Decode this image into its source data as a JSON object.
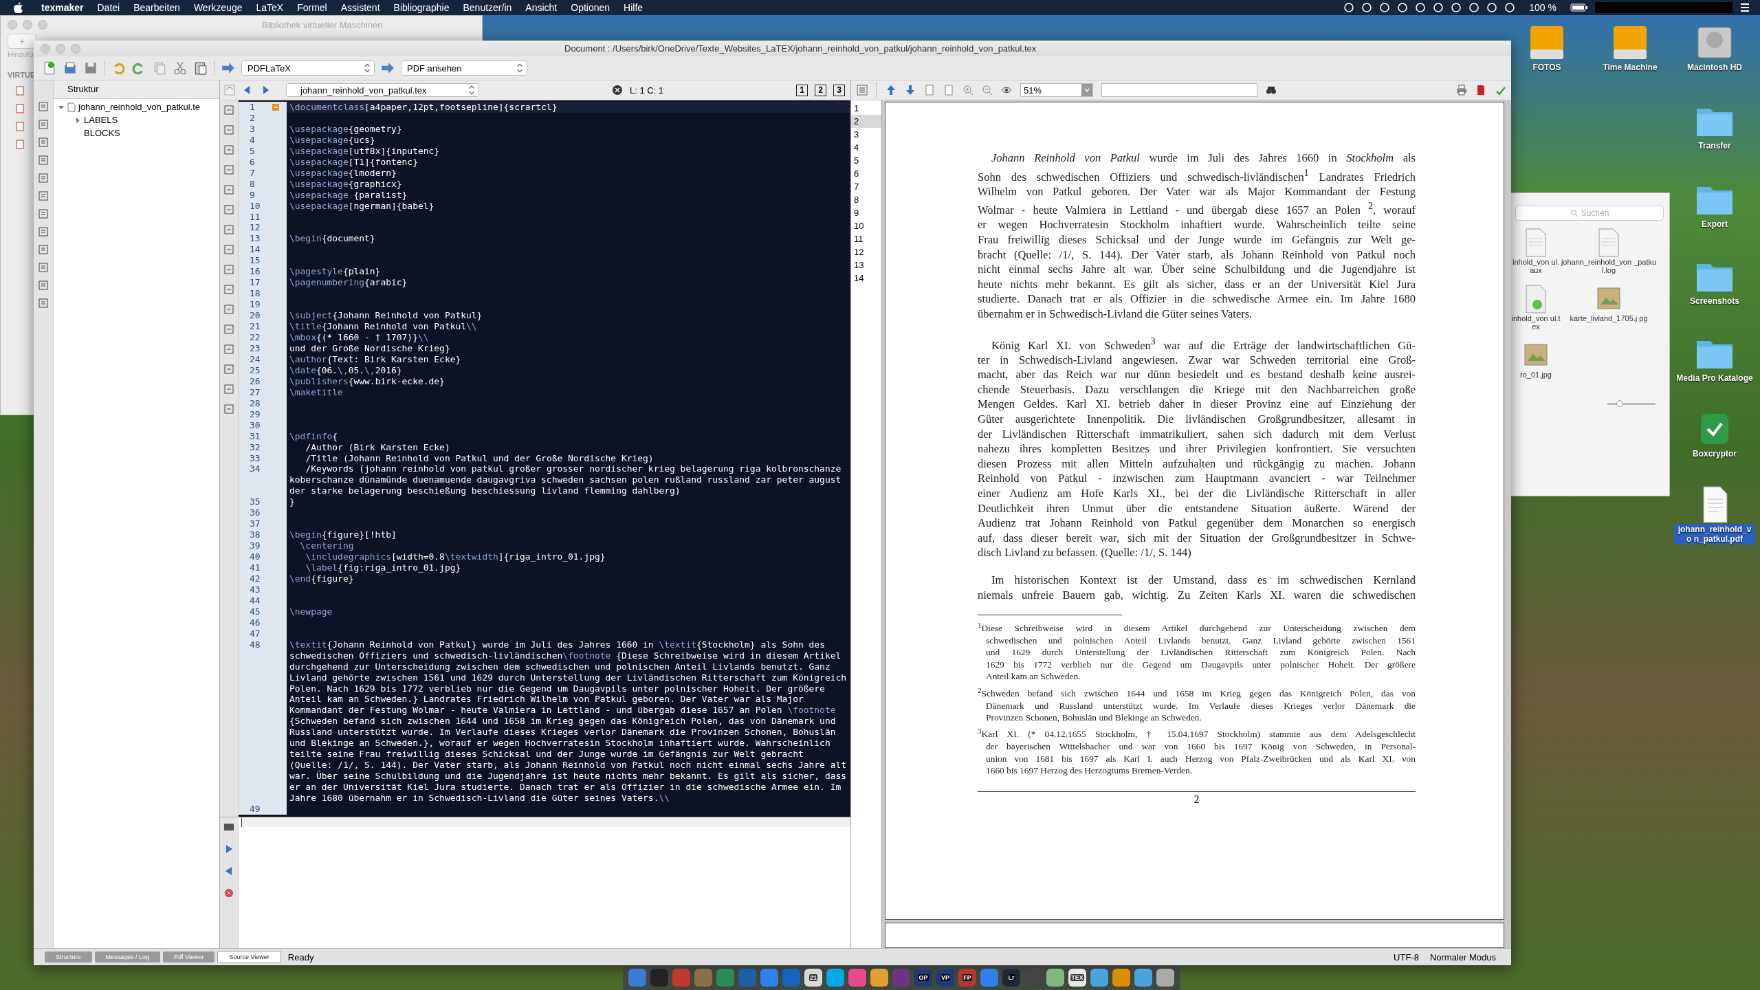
{
  "menubar": {
    "items": [
      {
        "label": "texmaker",
        "kind": "app"
      },
      {
        "label": "Datei",
        "kind": "menu"
      },
      {
        "label": "Bearbeiten",
        "kind": "menu"
      },
      {
        "label": "Werkzeuge",
        "kind": "menu"
      },
      {
        "label": "LaTeX",
        "kind": "menu"
      },
      {
        "label": "Formel",
        "kind": "menu"
      },
      {
        "label": "Assistent",
        "kind": "menu"
      },
      {
        "label": "Bibliographie",
        "kind": "menu"
      },
      {
        "label": "Benutzer/in",
        "kind": "menu"
      },
      {
        "label": "Ansicht",
        "kind": "menu"
      },
      {
        "label": "Optionen",
        "kind": "menu"
      },
      {
        "label": "Hilfe",
        "kind": "menu"
      }
    ],
    "battery": "100 %"
  },
  "vm_window": {
    "title": "Bibliothek virtueller Maschinen",
    "add_button": "+",
    "add_label": "Hinzufü",
    "section": "VIRTUE"
  },
  "desktop_icons": [
    {
      "label": "FOTOS",
      "kind": "drive",
      "selected": false
    },
    {
      "label": "Time Machine",
      "kind": "drive",
      "selected": false
    },
    {
      "label": "Macintosh HD",
      "kind": "disk",
      "selected": false
    },
    {
      "label": "Transfer",
      "kind": "folder",
      "selected": false
    },
    {
      "label": "Export",
      "kind": "folder",
      "selected": false
    },
    {
      "label": "Screenshots",
      "kind": "folder",
      "selected": false
    },
    {
      "label": "Media Pro Kataloge",
      "kind": "folder",
      "selected": false
    },
    {
      "label": "Boxcryptor",
      "kind": "app",
      "selected": false
    },
    {
      "label": "johann_reinhold_vo n_patkul.pdf",
      "kind": "document",
      "selected": true
    }
  ],
  "finder": {
    "search_placeholder": "Suchen",
    "files": [
      {
        "label": "inhold_von ul.aux",
        "kind": "document"
      },
      {
        "label": "johann_reinhold_von _patkul.log",
        "kind": "log"
      },
      {
        "label": "inhold_von ul.tex",
        "kind": "tex"
      },
      {
        "label": "karte_livland_1705.j pg",
        "kind": "image"
      },
      {
        "label": "ro_01.jpg",
        "kind": "image"
      }
    ],
    "icon_size": {
      "level": 0.25
    }
  },
  "window": {
    "title": "Document : /Users/birk/OneDrive/Texte_Websites_LaTEX/johann_reinhold_von_patkul/johann_reinhold_von_patkul.tex"
  },
  "toolbar": {
    "build_command": "PDFLaTeX",
    "view_command": "PDF ansehen"
  },
  "structure": {
    "title": "Struktur",
    "tree": [
      {
        "label": "johann_reinhold_von_patkul.te",
        "expanded": true,
        "children": [
          {
            "label": "LABELS",
            "expanded": false
          },
          {
            "label": "BLOCKS"
          }
        ]
      }
    ]
  },
  "editor": {
    "file_tab": "johann_reinhold_von_patkul.tex",
    "cursor": "L: 1 C: 1",
    "view_buttons": [
      "1",
      "2",
      "3"
    ],
    "lines": [
      {
        "n": "1",
        "text": "\\documentclass[a4paper,12pt,footsepline]{scrartcl}",
        "fold_start": true,
        "current": true
      },
      {
        "n": "2"
      },
      {
        "n": "3",
        "text": "\\usepackage{geometry}"
      },
      {
        "n": "4",
        "text": "\\usepackage{ucs}"
      },
      {
        "n": "5",
        "text": "\\usepackage[utf8x]{inputenc}"
      },
      {
        "n": "6",
        "text": "\\usepackage[T1]{fontenc}"
      },
      {
        "n": "7",
        "text": "\\usepackage{lmodern}"
      },
      {
        "n": "8",
        "text": "\\usepackage{graphicx}"
      },
      {
        "n": "9",
        "text": "\\usepackage {paralist}"
      },
      {
        "n": "10",
        "text": "\\usepackage[ngerman]{babel}"
      },
      {
        "n": "11"
      },
      {
        "n": "12"
      },
      {
        "n": "13",
        "text": "\\begin{document}"
      },
      {
        "n": "14"
      },
      {
        "n": "15"
      },
      {
        "n": "16",
        "text": "\\pagestyle{plain}"
      },
      {
        "n": "17",
        "text": "\\pagenumbering{arabic}"
      },
      {
        "n": "18"
      },
      {
        "n": "19"
      },
      {
        "n": "20",
        "text": "\\subject{Johann Reinhold von Patkul}"
      },
      {
        "n": "21",
        "text": "\\title{Johann Reinhold von Patkul\\\\"
      },
      {
        "n": "22",
        "text": "\\mbox{(* 1660 - † 1707)}\\\\"
      },
      {
        "n": "23",
        "text": "und der Große Nordische Krieg}"
      },
      {
        "n": "24",
        "text": "\\author{Text: Birk Karsten Ecke}"
      },
      {
        "n": "25",
        "text": "\\date{06.\\,05.\\,2016}"
      },
      {
        "n": "26",
        "text": "\\publishers{www.birk-ecke.de}"
      },
      {
        "n": "27",
        "text": "\\maketitle"
      },
      {
        "n": "28"
      },
      {
        "n": "29"
      },
      {
        "n": "30"
      },
      {
        "n": "31",
        "text": "\\pdfinfo{"
      },
      {
        "n": "32",
        "text": "   /Author (Birk Karsten Ecke)"
      },
      {
        "n": "33",
        "text": "   /Title (Johann Reinhold von Patkul und der Große Nordische Krieg)"
      },
      {
        "n": "34",
        "text": "   /Keywords (johann reinhold von patkul großer grosser nordischer krieg belagerung riga kolbronschanze koberschanze dünamünde duenamuende daugavgriva schweden sachsen polen rußland russland zar peter august der starke belagerung beschießung beschiessung livland flemming dahlberg)"
      },
      {
        "n": "35",
        "text": "}"
      },
      {
        "n": "36"
      },
      {
        "n": "37"
      },
      {
        "n": "38",
        "text": "\\begin{figure}[!htb]"
      },
      {
        "n": "39",
        "text": "  \\centering"
      },
      {
        "n": "40",
        "text": "   \\includegraphics[width=0.8\\textwidth]{riga_intro_01.jpg}"
      },
      {
        "n": "41",
        "text": "   \\label{fig:riga_intro_01.jpg}"
      },
      {
        "n": "42",
        "text": "\\end{figure}"
      },
      {
        "n": "43"
      },
      {
        "n": "44"
      },
      {
        "n": "45",
        "text": "\\newpage"
      },
      {
        "n": "46"
      },
      {
        "n": "47"
      },
      {
        "n": "48",
        "text": "\\textit{Johann Reinhold von Patkul} wurde im Juli des Jahres 1660 in \\textit{Stockholm} als Sohn des schwedischen Offiziers und schwedisch-livländischen\\footnote {Diese Schreibweise wird in diesem Artikel durchgehend zur Unterscheidung zwischen dem schwedischen und polnischen Anteil Livlands benutzt. Ganz Livland gehörte zwischen 1561 und 1629 durch Unterstellung der Livländischen Ritterschaft zum Königreich Polen. Nach 1629 bis 1772 verblieb nur die Gegend um Daugavpils unter polnischer Hoheit. Der größere Anteil kam an Schweden.} Landrates Friedrich Wilhelm von Patkul geboren. Der Vater war als Major Kommandant der Festung Wolmar - heute Valmiera in Lettland - und übergab diese 1657 an Polen \\footnote {Schweden befand sich zwischen 1644 und 1658 im Krieg gegen das Königreich Polen, das von Dänemark und Russland unterstützt wurde. Im Verlaufe dieses Krieges verlor Dänemark die Provinzen Schonen, Bohuslän und Blekinge an Schweden.}, worauf er wegen Hochverratesin Stockholm inhaftiert wurde. Wahrscheinlich teilte seine Frau freiwillig dieses Schicksal und der Junge wurde im Gefängnis zur Welt gebracht (Quelle: /1/, S. 144). Der Vater starb, als Johann Reinhold von Patkul noch nicht einmal sechs Jahre alt war. Über seine Schulbildung und die Jugendjahre ist heute nichts mehr bekannt. Es gilt als sicher, dass er an der Universität Kiel Jura studierte. Danach trat er als Offizier in die schwedische Armee ein. Im Jahre 1680 übernahm er in Schwedisch-Livland die Güter seines Vaters.\\\\"
      },
      {
        "n": "49"
      }
    ]
  },
  "pdf_viewer": {
    "zoom": "51%",
    "line_numbers": [
      {
        "n": "1",
        "selected": false
      },
      {
        "n": "2",
        "selected": true
      },
      {
        "n": "3",
        "selected": false
      },
      {
        "n": "4",
        "selected": false
      },
      {
        "n": "5",
        "selected": false
      },
      {
        "n": "6",
        "selected": false
      },
      {
        "n": "7",
        "selected": false
      },
      {
        "n": "8",
        "selected": false
      },
      {
        "n": "9",
        "selected": false
      },
      {
        "n": "10",
        "selected": false
      },
      {
        "n": "11",
        "selected": false
      },
      {
        "n": "12",
        "selected": false
      },
      {
        "n": "13",
        "selected": false
      },
      {
        "n": "14",
        "selected": false
      }
    ],
    "page": {
      "paragraphs": [
        {
          "continues": false,
          "lines": [
            "*Johann Reinhold von Patkul* wurde im Juli des Jahres 1660 in *Stockholm* als",
            "Sohn des schwedischen Offiziers und schwedisch-livländischen$^{1}$ Landrates Friedrich",
            "Wilhelm von Patkul geboren. Der Vater war als Major Kommandant der Festung",
            "Wolmar - heute Valmiera in Lettland - und übergab diese 1657 an Polen $^{2}$, worauf",
            "er wegen Hochverratesin Stockholm inhaftiert wurde. Wahrscheinlich teilte seine",
            "Frau freiwillig dieses Schicksal und der Junge wurde im Gefängnis zur Welt ge-",
            "bracht (Quelle: /1/, S. 144). Der Vater starb, als Johann Reinhold von Patkul noch",
            "nicht einmal sechs Jahre alt war. Über seine Schulbildung und die Jugendjahre ist",
            "heute nichts mehr bekannt. Es gilt als sicher, dass er an der Universität Kiel Jura",
            "studierte. Danach trat er als Offizier in die schwedische Armee ein. Im Jahre 1680",
            "übernahm er in Schwedisch-Livland die Güter seines Vaters."
          ]
        },
        {
          "continues": false,
          "lines": [
            "König Karl XI. von Schweden$^{3}$ war auf die Erträge der landwirtschaftlichen Gü-",
            "ter in Schwedisch-Livland angewiesen. Zwar war Schweden territorial eine Groß-",
            "macht, aber das Reich war nur dünn besiedelt und es bestand deshalb keine ausrei-",
            "chende Steuerbasis. Dazu verschlangen die Kriege mit den Nachbarreichen große",
            "Mengen Geldes. Karl XI. betrieb daher in dieser Provinz eine auf Einziehung der",
            "Güter ausgerichtete Innenpolitik. Die livländischen Großgrundbesitzer, allesamt in",
            "der Livländischen Ritterschaft immatrikuliert, sahen sich dadurch mit dem Verlust",
            "nahezu ihres kompletten Besitzes und ihrer Privilegien konfrontiert. Sie versuchten",
            "diesen Prozess mit allen Mitteln aufzuhalten und rückgängig zu machen. Johann",
            "Reinhold von Patkul - inzwischen zum Hauptmann avanciert - war Teilnehmer",
            "einer Audienz am Hofe Karls XI., bei der die Livländische Ritterschaft in aller",
            "Deutlichkeit ihren Unmut über die entstandene Situation äußerte. Wärend der",
            "Audienz trat Johann Reinhold von Patkul gegenüber dem Monarchen so energisch",
            "auf, dass dieser bereit war, sich mit der Situation der Großgrundbesitzer in Schwe-",
            "disch Livland zu befassen. (Quelle: /1/, S. 144)"
          ]
        },
        {
          "continues": true,
          "lines": [
            "Im historischen Kontext ist der Umstand, dass es im schwedischen Kernland",
            "niemals unfreie Bauern gab, wichtig. Zu Zeiten Karls XI. waren die schwedischen"
          ]
        }
      ],
      "footnotes": [
        {
          "lines": [
            "$^{1}$Diese Schreibweise wird in diesem Artikel durchgehend zur Unterscheidung zwischen dem",
            "schwedischen und polnischen Anteil Livlands benutzt. Ganz Livland gehörte zwischen 1561",
            "und 1629 durch Unterstellung der Livländischen Ritterschaft zum Königreich Polen. Nach",
            "1629 bis 1772 verblieb nur die Gegend um Daugavpils unter polnischer Hoheit. Der größere",
            "Anteil kam an Schweden."
          ]
        },
        {
          "lines": [
            "$^{2}$Schweden befand sich zwischen 1644 und 1658 im Krieg gegen das Königreich Polen, das von",
            "Dänemark und Russland unterstützt wurde. Im Verlaufe dieses Krieges verlor Dänemark die",
            "Provinzen Schonen, Bohuslän und Blekinge an Schweden."
          ]
        },
        {
          "lines": [
            "$^{3}$Karl XI. (* 04.12.1655 Stockholm, † 15.04.1697 Stockholm) stammte aus dem Adelsgeschlecht",
            "der bayerischen Wittelsbacher und war von 1660 bis 1697 König von Schweden, in Personal-",
            "union von 1681 bis 1697 als Karl I. auch Herzog von Pfalz-Zweibrücken und als Karl XI. von",
            "1660 bis 1697 Herzog des Herzogtums Bremen-Verden."
          ]
        }
      ],
      "page_number": "2"
    }
  },
  "bottom_tabs": [
    {
      "label": "Structure",
      "selected": false
    },
    {
      "label": "Messages / Log",
      "selected": false
    },
    {
      "label": "Pdf Viewer",
      "selected": false
    },
    {
      "label": "Source Viewer",
      "selected": true
    }
  ],
  "status": {
    "message": "Ready",
    "encoding": "UTF-8",
    "mode": "Normaler Modus"
  },
  "dock": [
    {
      "color": "#3a7bd5"
    },
    {
      "color": "#222222"
    },
    {
      "color": "#c0392b"
    },
    {
      "color": "#8b6d4a"
    },
    {
      "color": "#2e8b57"
    },
    {
      "color": "#1e5fa8"
    },
    {
      "color": "#2f80ed"
    },
    {
      "color": "#1565c0"
    },
    {
      "color": "#d9d9d9",
      "label": "21"
    },
    {
      "color": "#00a8e8"
    },
    {
      "color": "#e84a8a"
    },
    {
      "color": "#e0a030"
    },
    {
      "color": "#6c3483"
    },
    {
      "color": "#1f3b73",
      "label": "OP"
    },
    {
      "color": "#1f3b73",
      "label": "VP"
    },
    {
      "color": "#b03a2e",
      "label": "FP"
    },
    {
      "color": "#2f80ed"
    },
    {
      "color": "#1b2838",
      "label": "Lr"
    },
    {
      "color": "#444444"
    },
    {
      "color": "#7fb77e"
    },
    {
      "color": "#e8e8e8",
      "label": "TEX"
    },
    {
      "color": "#4aa3df"
    },
    {
      "color": "#d98e04"
    },
    {
      "color": "#4aa3df"
    },
    {
      "color": "#aaaaaa"
    }
  ]
}
